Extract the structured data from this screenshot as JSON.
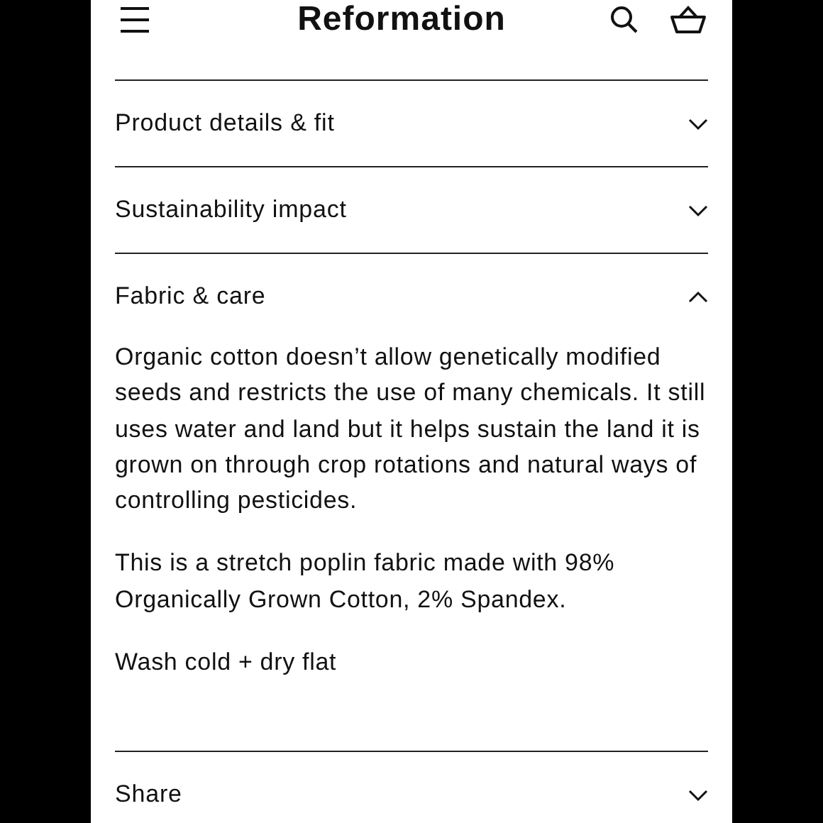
{
  "header": {
    "brand": "Reformation"
  },
  "sections": [
    {
      "title": "Product details & fit",
      "expanded": false
    },
    {
      "title": "Sustainability impact",
      "expanded": false
    },
    {
      "title": "Fabric & care",
      "expanded": true,
      "paragraphs": [
        "Organic cotton doesn’t allow genetically modified seeds and restricts the use of many chemicals. It still uses water and land but it helps sustain the land it is grown on through crop rotations and natural ways of controlling pesticides.",
        "This is a stretch poplin fabric made with 98% Organically Grown Cotton, 2% Spandex.",
        "Wash cold + dry flat"
      ]
    },
    {
      "title": "Share",
      "expanded": false
    }
  ]
}
